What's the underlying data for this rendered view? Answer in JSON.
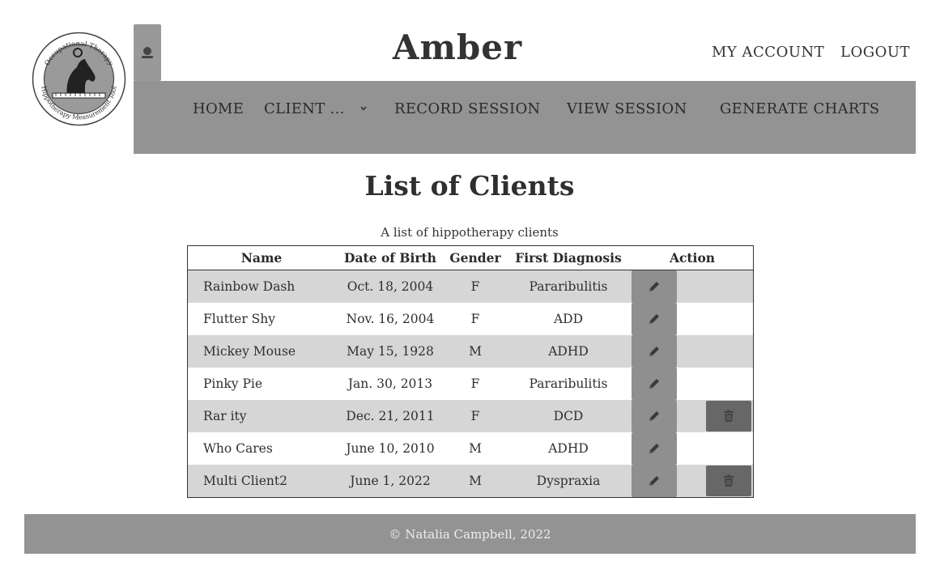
{
  "logo": {
    "top_text": "Occupational Therapy",
    "bottom_text": "Hippotherapy Measurement Tool"
  },
  "header": {
    "title": "Amber",
    "account_label": "MY ACCOUNT",
    "logout_label": "LOGOUT"
  },
  "nav": {
    "home": "HOME",
    "client": "CLIENT ...",
    "record_session": "RECORD SESSION",
    "view_session": "VIEW SESSION",
    "generate_charts": "GENERATE CHARTS"
  },
  "main": {
    "title": "List of Clients",
    "caption": "A list of hippotherapy clients",
    "columns": {
      "name": "Name",
      "dob": "Date of Birth",
      "gender": "Gender",
      "diagnosis": "First Diagnosis",
      "action": "Action"
    },
    "rows": [
      {
        "name": "Rainbow Dash",
        "dob": "Oct. 18, 2004",
        "gender": "F",
        "diagnosis": "Pararibulitis",
        "deletable": false
      },
      {
        "name": "Flutter Shy",
        "dob": "Nov. 16, 2004",
        "gender": "F",
        "diagnosis": "ADD",
        "deletable": false
      },
      {
        "name": "Mickey Mouse",
        "dob": "May 15, 1928",
        "gender": "M",
        "diagnosis": "ADHD",
        "deletable": false
      },
      {
        "name": "Pinky Pie",
        "dob": "Jan. 30, 2013",
        "gender": "F",
        "diagnosis": "Pararibulitis",
        "deletable": false
      },
      {
        "name": "Rar ity",
        "dob": "Dec. 21, 2011",
        "gender": "F",
        "diagnosis": "DCD",
        "deletable": true
      },
      {
        "name": "Who Cares",
        "dob": "June 10, 2010",
        "gender": "M",
        "diagnosis": "ADHD",
        "deletable": false
      },
      {
        "name": "Multi Client2",
        "dob": "June 1, 2022",
        "gender": "M",
        "diagnosis": "Dyspraxia",
        "deletable": true
      }
    ]
  },
  "footer": {
    "text": "© Natalia Campbell, 2022"
  },
  "icons": {
    "profile": "user-icon",
    "edit": "pencil-icon",
    "delete": "trash-icon",
    "dropdown": "chevron-down-icon"
  },
  "colors": {
    "nav_bg": "#939393",
    "footer_bg": "#939393",
    "row_shaded": "#d6d6d6",
    "edit_btn": "#8f8f8f",
    "delete_btn": "#676767"
  }
}
